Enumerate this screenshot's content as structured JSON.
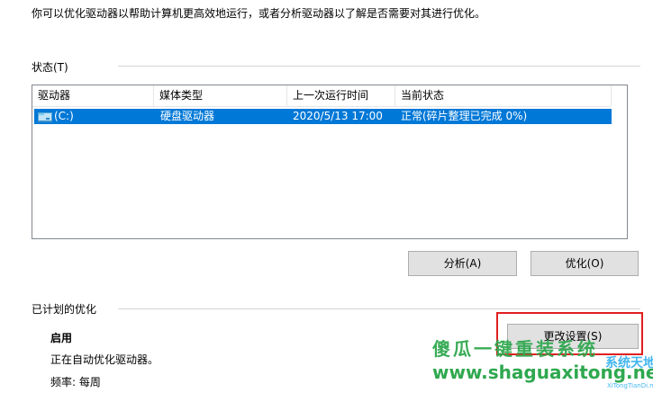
{
  "intro_text": "你可以优化驱动器以帮助计算机更高效地运行，或者分析驱动器以了解是否需要对其进行优化。",
  "status": {
    "label": "状态(T)",
    "columns": [
      "驱动器",
      "媒体类型",
      "上一次运行时间",
      "当前状态"
    ],
    "rows": [
      {
        "drive": "(C:)",
        "media_type": "硬盘驱动器",
        "last_run": "2020/5/13 17:00",
        "current_status": "正常(碎片整理已完成 0%)"
      }
    ]
  },
  "buttons": {
    "analyze": "分析(A)",
    "optimize": "优化(O)",
    "change_settings": "更改设置(S)"
  },
  "scheduled": {
    "label": "已计划的优化",
    "state": "启用",
    "description": "正在自动优化驱动器。",
    "frequency": "频率: 每周"
  },
  "watermark": {
    "text": "傻瓜一键重装系统",
    "url": "www.shaguaxitong.net",
    "logo": "系统天地",
    "logo_sub": "XiTongTianDi.net"
  },
  "colors": {
    "selection": "#0078d7",
    "highlight_box": "#e02020",
    "watermark": "#2fa84f"
  },
  "icons": {
    "drive": "hard-drive-icon"
  }
}
